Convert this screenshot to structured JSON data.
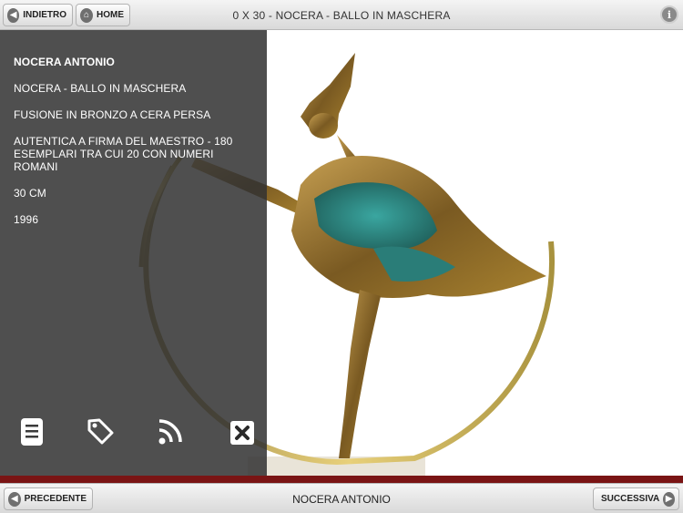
{
  "header": {
    "back_label": "INDIETRO",
    "home_label": "HOME",
    "title": "0 X 30 - NOCERA - BALLO IN MASCHERA",
    "info_icon": "i"
  },
  "info_panel": {
    "lines": [
      "NOCERA ANTONIO",
      "NOCERA - BALLO IN MASCHERA",
      "FUSIONE IN BRONZO A CERA PERSA",
      "AUTENTICA A FIRMA DEL MAESTRO - 180 ESEMPLARI TRA CUI 20 CON NUMERI ROMANI",
      "30 CM",
      "1996"
    ],
    "icons": [
      "document-icon",
      "tag-icon",
      "rss-icon",
      "close-icon"
    ]
  },
  "footer": {
    "prev_label": "PRECEDENTE",
    "title": "NOCERA ANTONIO",
    "next_label": "SUCCESSIVA"
  },
  "colors": {
    "panel": "#323232",
    "accent_red": "#7a1414",
    "bronze": "#8a6a2a",
    "patina": "#2f8a86"
  }
}
